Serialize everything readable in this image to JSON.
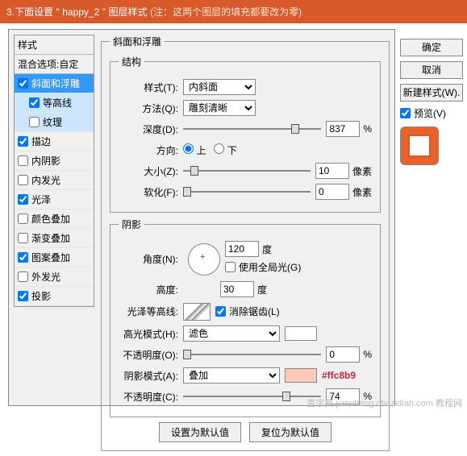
{
  "header": {
    "step": "3.下面设置",
    "name": "\" happy_2 \"",
    "tail": "图层样式",
    "note": "(注：这两个图层的填充都要改为零)"
  },
  "right": {
    "ok": "确定",
    "cancel": "取消",
    "newstyle": "新建样式(W).",
    "preview": "预览(V)"
  },
  "left": {
    "title": "样式",
    "blend": "混合选项:自定",
    "items": [
      {
        "label": "斜面和浮雕",
        "checked": true,
        "sel": true
      },
      {
        "label": "等高线",
        "checked": true,
        "sub": true,
        "sel2": true
      },
      {
        "label": "纹理",
        "checked": false,
        "sub": true,
        "sel2": true
      },
      {
        "label": "描边",
        "checked": true
      },
      {
        "label": "内阴影",
        "checked": false
      },
      {
        "label": "内发光",
        "checked": false
      },
      {
        "label": "光泽",
        "checked": true
      },
      {
        "label": "颜色叠加",
        "checked": false
      },
      {
        "label": "渐变叠加",
        "checked": false
      },
      {
        "label": "图案叠加",
        "checked": true
      },
      {
        "label": "外发光",
        "checked": false
      },
      {
        "label": "投影",
        "checked": true
      }
    ]
  },
  "panel_title": "斜面和浮雕",
  "struct": {
    "legend": "结构",
    "style_l": "样式(T):",
    "style_v": "内斜面",
    "method_l": "方法(Q):",
    "method_v": "雕刻清晰",
    "depth_l": "深度(D):",
    "depth_v": "837",
    "pct": "%",
    "dir_l": "方向:",
    "up": "上",
    "down": "下",
    "size_l": "大小(Z):",
    "size_v": "10",
    "px": "像素",
    "soft_l": "软化(F):",
    "soft_v": "0"
  },
  "shade": {
    "legend": "阴影",
    "angle_l": "角度(N):",
    "angle_v": "120",
    "deg": "度",
    "global": "使用全局光(G)",
    "alt_l": "高度:",
    "alt_v": "30",
    "contour_l": "光泽等高线:",
    "aa": "消除锯齿(L)",
    "hi_l": "高光模式(H):",
    "hi_v": "滤色",
    "hi_op_l": "不透明度(O):",
    "hi_op_v": "0",
    "sh_l": "阴影模式(A):",
    "sh_v": "叠加",
    "hex": "#ffc8b9",
    "sh_op_l": "不透明度(C):",
    "sh_op_v": "74"
  },
  "btns": {
    "def": "设置为默认值",
    "reset": "复位为默认值"
  },
  "footer": "查字典  jiaocheng.chazidian.com  教程网"
}
